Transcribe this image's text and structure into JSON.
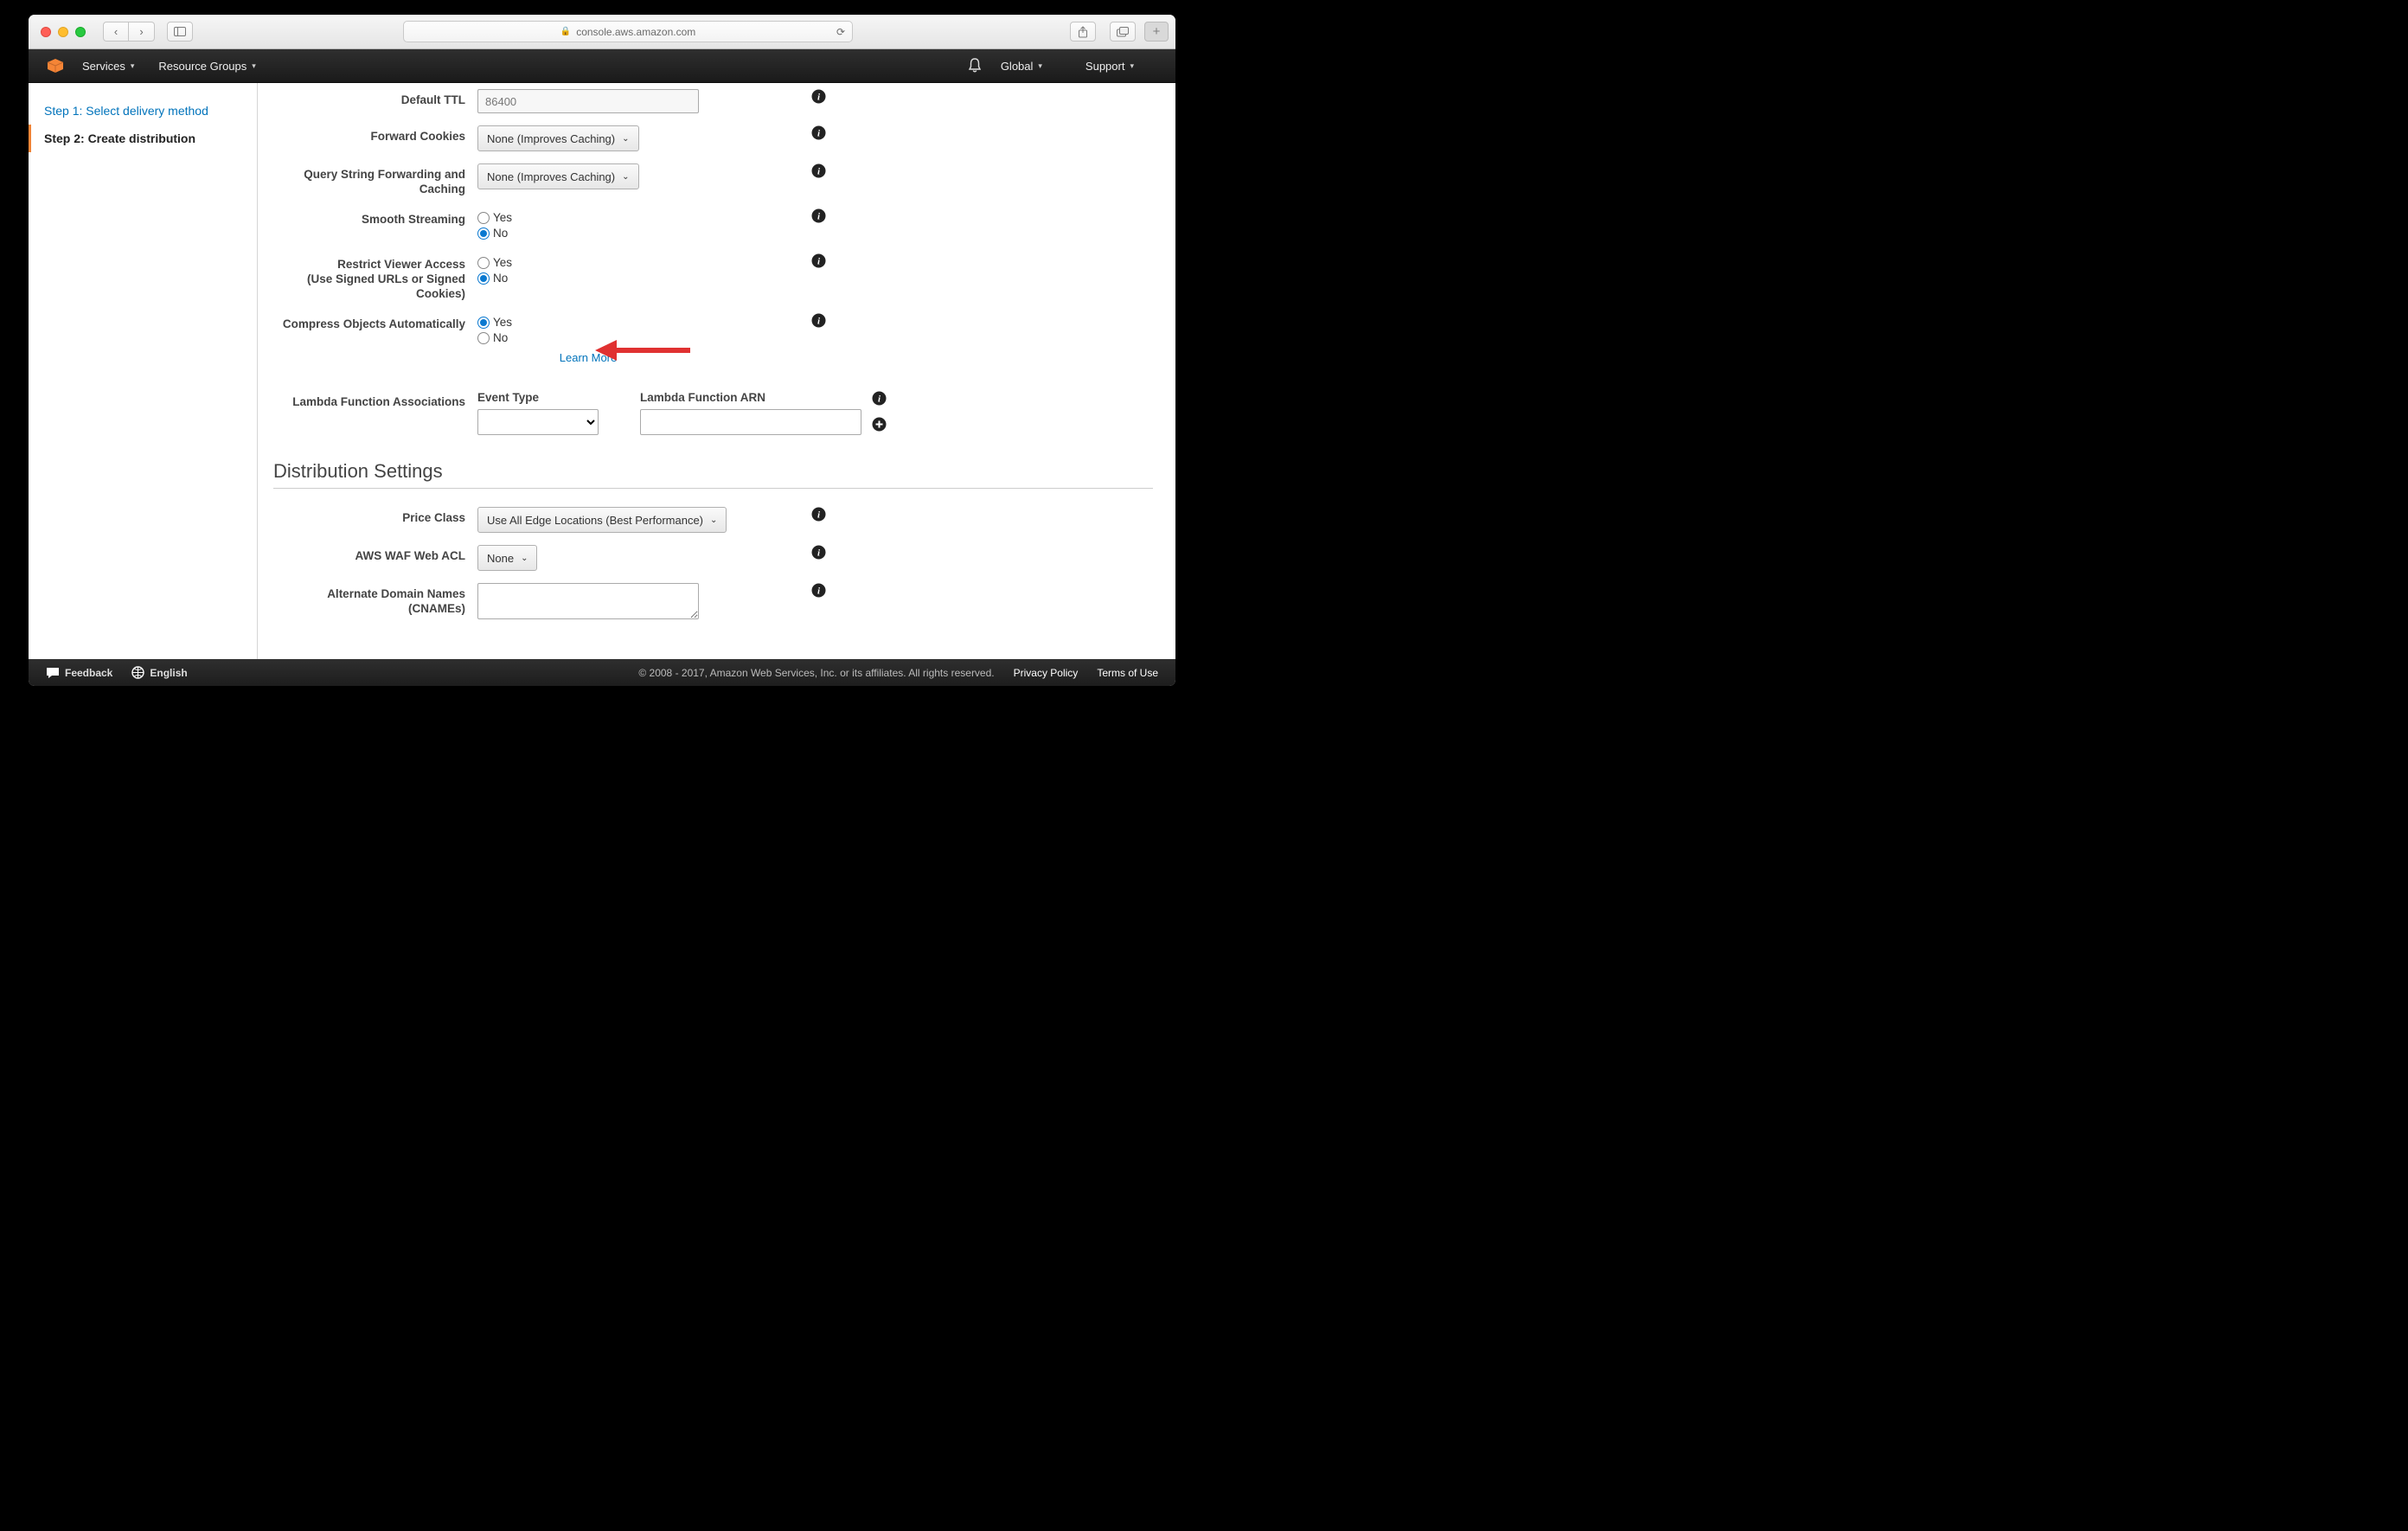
{
  "browser": {
    "url": "console.aws.amazon.com"
  },
  "header": {
    "services": "Services",
    "resource_groups": "Resource Groups",
    "region": "Global",
    "support": "Support"
  },
  "sidebar": {
    "step1": "Step 1: Select delivery method",
    "step2": "Step 2: Create distribution"
  },
  "form": {
    "default_ttl_label": "Default TTL",
    "default_ttl_value": "86400",
    "forward_cookies_label": "Forward Cookies",
    "forward_cookies_value": "None (Improves Caching)",
    "query_string_label": "Query String Forwarding and Caching",
    "query_string_value": "None (Improves Caching)",
    "smooth_streaming_label": "Smooth Streaming",
    "restrict_viewer_label": "Restrict Viewer Access\n(Use Signed URLs or Signed Cookies)",
    "compress_label": "Compress Objects Automatically",
    "radio_yes": "Yes",
    "radio_no": "No",
    "learn_more": "Learn More",
    "lambda_assoc_label": "Lambda Function Associations",
    "lambda_event_type": "Event Type",
    "lambda_arn": "Lambda Function ARN"
  },
  "distribution": {
    "heading": "Distribution Settings",
    "price_class_label": "Price Class",
    "price_class_value": "Use All Edge Locations (Best Performance)",
    "waf_label": "AWS WAF Web ACL",
    "waf_value": "None",
    "cname_label": "Alternate Domain Names\n(CNAMEs)"
  },
  "footer": {
    "feedback": "Feedback",
    "language": "English",
    "copyright": "© 2008 - 2017, Amazon Web Services, Inc. or its affiliates. All rights reserved.",
    "privacy": "Privacy Policy",
    "terms": "Terms of Use"
  }
}
